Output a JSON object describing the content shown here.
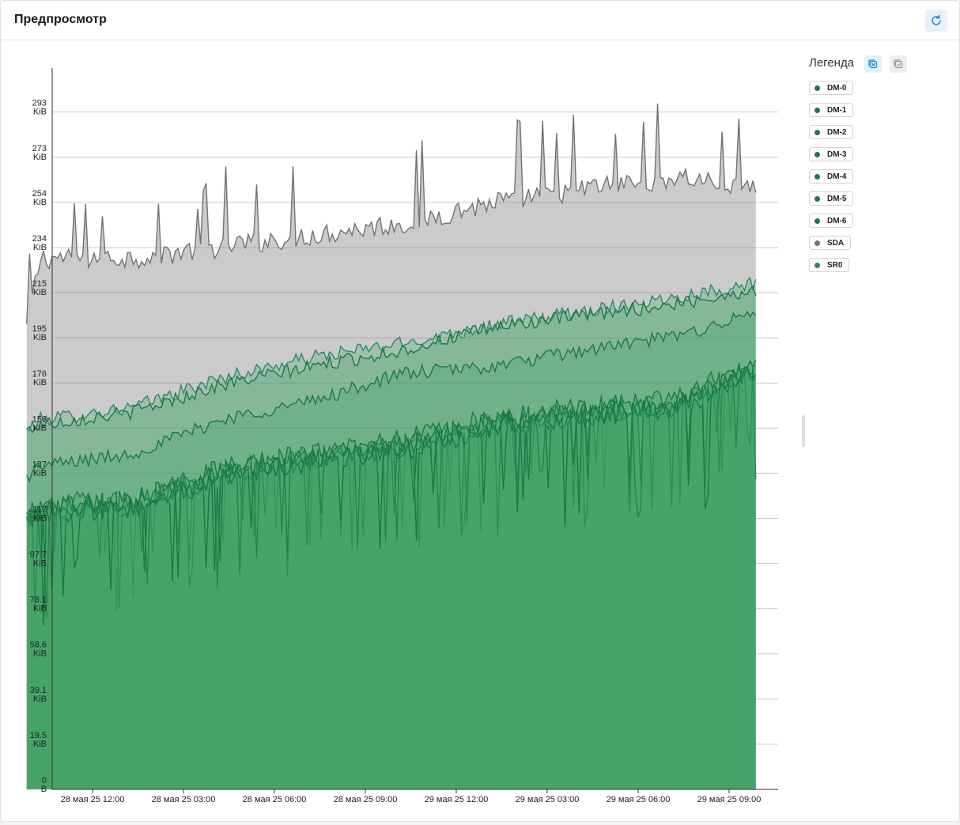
{
  "header": {
    "title": "Предпросмотр",
    "refresh_icon": "refresh-icon"
  },
  "legend": {
    "title": "Легенда",
    "select_all_icon": "select-all-icon",
    "deselect_all_icon": "deselect-all-icon",
    "items": [
      {
        "label": "DM-0",
        "color": "#1a7a45"
      },
      {
        "label": "DM-1",
        "color": "#1a7a45"
      },
      {
        "label": "DM-2",
        "color": "#1a7a45"
      },
      {
        "label": "DM-3",
        "color": "#1a7a45"
      },
      {
        "label": "DM-4",
        "color": "#1a7a45"
      },
      {
        "label": "DM-5",
        "color": "#1a7a45"
      },
      {
        "label": "DM-6",
        "color": "#1a7a45"
      },
      {
        "label": "SDA",
        "color": "#737373"
      },
      {
        "label": "SR0",
        "color": "#2e8b62"
      }
    ]
  },
  "chart_data": {
    "type": "area",
    "title": "",
    "xlabel": "",
    "ylabel": "",
    "stacked": false,
    "grid": true,
    "legend_position": "right",
    "x_tick_labels": [
      "28 мая 25 12:00",
      "28 мая 25 03:00",
      "28 мая 25 06:00",
      "28 мая 25 09:00",
      "29 мая 25 12:00",
      "29 мая 25 03:00",
      "29 мая 25 06:00",
      "29 мая 25 09:00"
    ],
    "y_tick_labels": [
      "0 B",
      "19.5 KiB",
      "39.1 KiB",
      "58.6 KiB",
      "78.1 KiB",
      "97.7 KiB",
      "117 KiB",
      "137 KiB",
      "156 KiB",
      "176 KiB",
      "195 KiB",
      "215 KiB",
      "234 KiB",
      "254 KiB",
      "273 KiB",
      "293 KiB"
    ],
    "ylim": [
      0,
      312
    ],
    "x_unit": "hours since first tick (28 мая 25 12:00)",
    "x": [
      -0.45,
      0,
      3,
      6,
      9,
      12,
      15,
      18,
      21,
      23.6
    ],
    "series": [
      {
        "name": "SDA",
        "values": [
          200,
          230,
          230,
          235,
          240,
          245,
          254,
          260,
          265,
          260
        ]
      },
      {
        "name": "SR0",
        "values": [
          155,
          160,
          165,
          178,
          187,
          193,
          201,
          207,
          213,
          219
        ]
      },
      {
        "name": "DM-0",
        "values": [
          155,
          158,
          163,
          175,
          183,
          190,
          200,
          205,
          210,
          216
        ]
      },
      {
        "name": "DM-1",
        "values": [
          135,
          140,
          145,
          160,
          168,
          180,
          183,
          190,
          196,
          206
        ]
      },
      {
        "name": "DM-2",
        "values": [
          118,
          124,
          126,
          140,
          146,
          152,
          162,
          166,
          170,
          186
        ]
      },
      {
        "name": "DM-3",
        "values": [
          117,
          123,
          125,
          138,
          145,
          150,
          160,
          164,
          168,
          184
        ]
      },
      {
        "name": "DM-4",
        "values": [
          116,
          122,
          124,
          137,
          144,
          149,
          159,
          163,
          167,
          183
        ]
      },
      {
        "name": "DM-5",
        "values": [
          115,
          121,
          123,
          136,
          143,
          148,
          158,
          162,
          166,
          182
        ]
      },
      {
        "name": "DM-6",
        "values": [
          114,
          120,
          122,
          135,
          142,
          147,
          157,
          161,
          165,
          181
        ]
      }
    ]
  }
}
